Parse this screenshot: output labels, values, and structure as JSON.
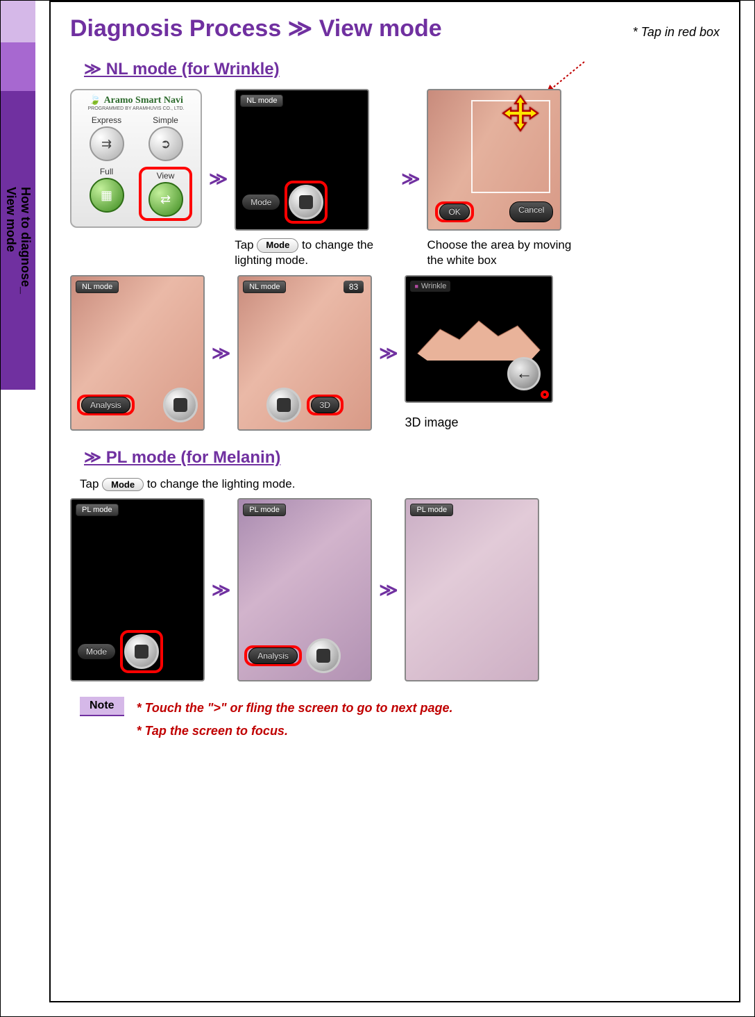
{
  "sidebar": {
    "label_prefix": "How to diagnose_ ",
    "label_accent": "View mode"
  },
  "header": {
    "title": "Diagnosis Process ≫ View mode",
    "tip": "* Tap in red box"
  },
  "sections": {
    "nl": {
      "heading": "≫ NL mode (for Wrinkle)"
    },
    "pl": {
      "heading": "≫ PL mode (for Melanin)"
    }
  },
  "app_menu": {
    "brand": "Aramo Smart Navi",
    "subtitle": "PROGRAMMED BY ARAMHUVIS CO., LTD.",
    "items": [
      "Express",
      "Simple",
      "Full",
      "View"
    ]
  },
  "badges": {
    "nl": "NL mode",
    "pl": "PL mode",
    "wrinkle": "Wrinkle",
    "score": "83"
  },
  "buttons": {
    "mode": "Mode",
    "analysis": "Analysis",
    "three_d": "3D",
    "ok": "OK",
    "cancel": "Cancel"
  },
  "captions": {
    "tap_mode_prefix": "Tap ",
    "tap_mode_suffix": " to change the lighting mode.",
    "choose_area": "Choose the area by moving the white box",
    "three_d_image": "3D image",
    "pl_tap": " to change the lighting mode."
  },
  "note": {
    "label": "Note",
    "line1": "* Touch the \">\" or fling the screen to go to next page.",
    "line2": "* Tap the screen to focus."
  }
}
